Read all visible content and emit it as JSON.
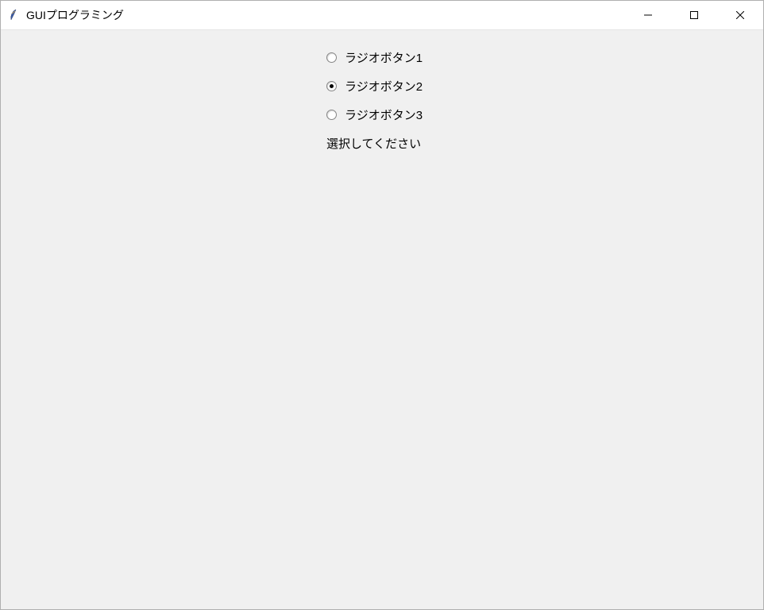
{
  "window": {
    "title": "GUIプログラミング"
  },
  "radios": [
    {
      "label": "ラジオボタン1",
      "selected": false
    },
    {
      "label": "ラジオボタン2",
      "selected": true
    },
    {
      "label": "ラジオボタン3",
      "selected": false
    }
  ],
  "message": "選択してください"
}
